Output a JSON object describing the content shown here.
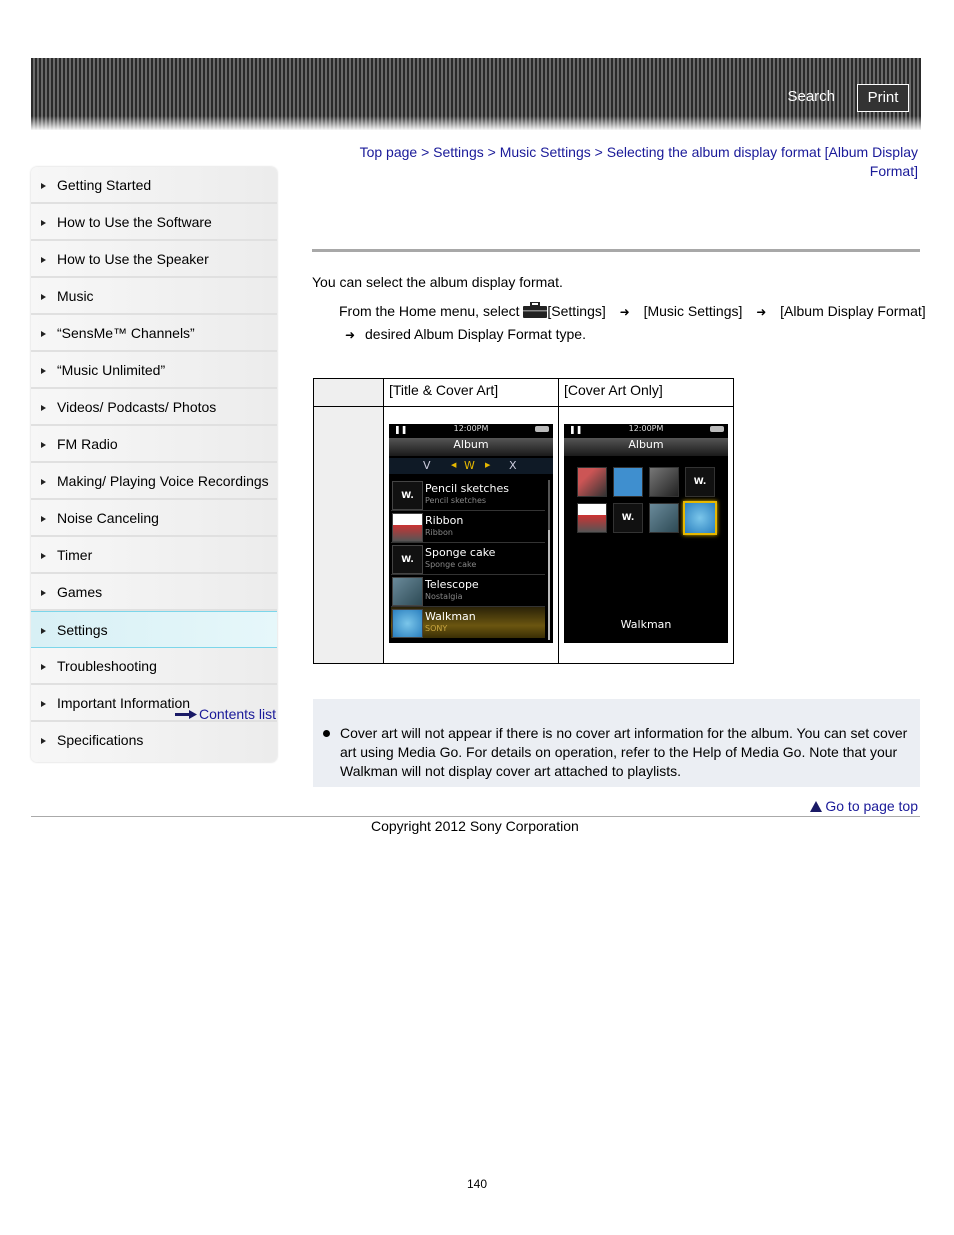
{
  "header": {
    "search_label": "Search",
    "print_label": "Print"
  },
  "sidebar": {
    "items": [
      {
        "label": "Getting Started"
      },
      {
        "label": "How to Use the Software"
      },
      {
        "label": "How to Use the Speaker"
      },
      {
        "label": "Music"
      },
      {
        "label": "“SensMe™ Channels”"
      },
      {
        "label": "“Music Unlimited”"
      },
      {
        "label": "Videos/ Podcasts/ Photos"
      },
      {
        "label": "FM Radio"
      },
      {
        "label": "Making/ Playing Voice Recordings"
      },
      {
        "label": "Noise Canceling"
      },
      {
        "label": "Timer"
      },
      {
        "label": "Games"
      },
      {
        "label": "Settings",
        "active": true
      },
      {
        "label": "Troubleshooting"
      },
      {
        "label": "Important Information"
      },
      {
        "label": "Specifications"
      }
    ],
    "contents_list": "Contents list"
  },
  "breadcrumb": {
    "items": [
      "Top page",
      "Settings",
      "Music Settings",
      "Selecting the album display format [Album Display Format]"
    ],
    "separator": ">"
  },
  "content": {
    "intro": "You can select the album display format.",
    "step_prefix": "From the Home menu, select",
    "step_settings": "[Settings]",
    "step_music_settings": "[Music Settings]",
    "step_album_format": "[Album Display Format]",
    "step_final": "desired Album Display Format type.",
    "arrow_glyph": "➜",
    "table": {
      "headers": [
        "",
        "[Title & Cover Art]",
        "[Cover Art Only]"
      ],
      "screen_common": {
        "time": "12:00PM",
        "title": "Album"
      },
      "list_letters": [
        "V",
        "W",
        "X"
      ],
      "list_rows": [
        {
          "title": "Pencil sketches",
          "subtitle": "Pencil sketches"
        },
        {
          "title": "Ribbon",
          "subtitle": "Ribbon"
        },
        {
          "title": "Sponge cake",
          "subtitle": "Sponge cake"
        },
        {
          "title": "Telescope",
          "subtitle": "Nostalgia"
        },
        {
          "title": "Walkman",
          "subtitle": "SONY",
          "selected": true
        }
      ],
      "grid_selected_label": "Walkman"
    },
    "note": "Cover art will not appear if there is no cover art information for the album. You can set cover art using Media Go. For details on operation, refer to the Help of Media Go. Note that your Walkman will not display cover art attached to playlists."
  },
  "footer": {
    "go_to_top": "Go to page top",
    "copyright": "Copyright 2012 Sony Corporation",
    "page_number": "140"
  }
}
